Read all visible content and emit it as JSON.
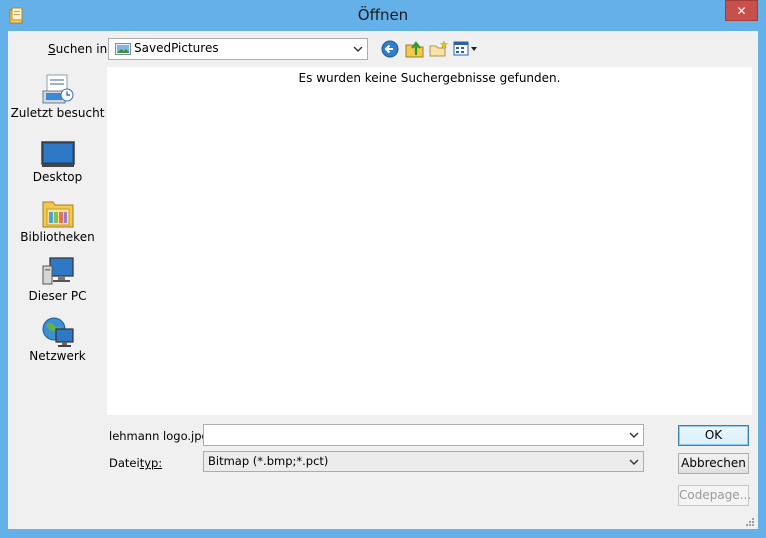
{
  "window": {
    "title": "Öffnen",
    "close_glyph": "✕"
  },
  "toolbar": {
    "look_in_label_prefix": "S",
    "look_in_label_rest": "uchen in:",
    "location_value": "SavedPictures",
    "icons": [
      "back-icon",
      "up-folder-icon",
      "new-folder-icon",
      "view-menu-icon"
    ]
  },
  "places": [
    {
      "label": "Zuletzt besucht",
      "icon": "recent-icon"
    },
    {
      "label": "Desktop",
      "icon": "desktop-icon"
    },
    {
      "label": "Bibliotheken",
      "icon": "libraries-icon"
    },
    {
      "label": "Dieser PC",
      "icon": "computer-icon"
    },
    {
      "label": "Netzwerk",
      "icon": "network-icon"
    }
  ],
  "filelist": {
    "empty_message": "Es wurden keine Suchergebnisse gefunden."
  },
  "form": {
    "filename_label": "lehmann logo.jpg",
    "filename_value": "",
    "filetype_label_prefix": "Datei",
    "filetype_label_rest": "typ:",
    "filetype_value": "Bitmap (*.bmp;*.pct)"
  },
  "buttons": {
    "ok": "OK",
    "cancel": "Abbrechen",
    "codepage": "Codepage..."
  },
  "colors": {
    "titlebar": "#64b0e8",
    "close": "#c7504b",
    "face": "#f0f0f0"
  }
}
